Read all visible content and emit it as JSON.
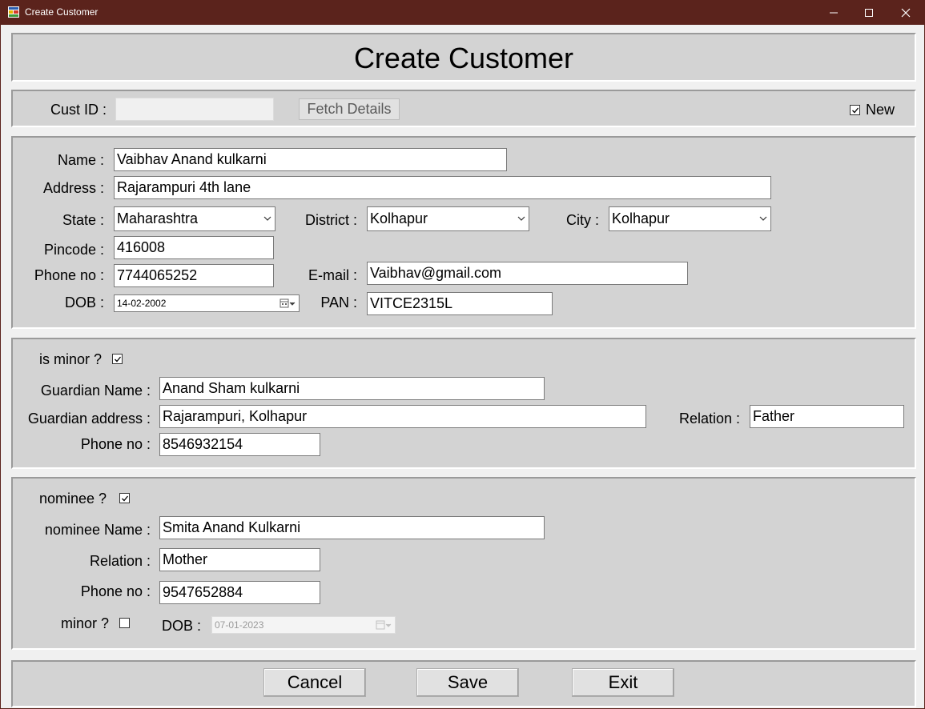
{
  "window": {
    "title": "Create Customer"
  },
  "header": {
    "title": "Create Customer"
  },
  "fetch": {
    "cust_id_label": "Cust ID :",
    "cust_id_value": "",
    "fetch_button": "Fetch Details",
    "new_label": "New",
    "new_checked": true
  },
  "customer": {
    "name_label": "Name :",
    "name": "Vaibhav Anand kulkarni",
    "address_label": "Address :",
    "address": "Rajarampuri 4th lane",
    "state_label": "State :",
    "state": "Maharashtra",
    "district_label": "District :",
    "district": "Kolhapur",
    "city_label": "City :",
    "city": "Kolhapur",
    "pincode_label": "Pincode :",
    "pincode": "416008",
    "phone_label": "Phone no :",
    "phone": "7744065252",
    "email_label": "E-mail :",
    "email": "Vaibhav@gmail.com",
    "dob_label": "DOB :",
    "dob": "14-02-2002",
    "pan_label": "PAN :",
    "pan": "VITCE2315L"
  },
  "minor": {
    "is_minor_label": "is minor ?",
    "is_minor_checked": true,
    "guardian_name_label": "Guardian Name :",
    "guardian_name": "Anand Sham kulkarni",
    "guardian_address_label": "Guardian address :",
    "guardian_address": "Rajarampuri, Kolhapur",
    "relation_label": "Relation :",
    "relation": "Father",
    "phone_label": "Phone no :",
    "phone": "8546932154"
  },
  "nominee": {
    "nominee_label": "nominee ?",
    "nominee_checked": true,
    "name_label": "nominee Name :",
    "name": "Smita Anand Kulkarni",
    "relation_label": "Relation :",
    "relation": "Mother",
    "phone_label": "Phone no :",
    "phone": "9547652884",
    "minor_label": "minor ?",
    "minor_checked": false,
    "dob_label": "DOB :",
    "dob": "07-01-2023"
  },
  "actions": {
    "cancel": "Cancel",
    "save": "Save",
    "exit": "Exit"
  }
}
